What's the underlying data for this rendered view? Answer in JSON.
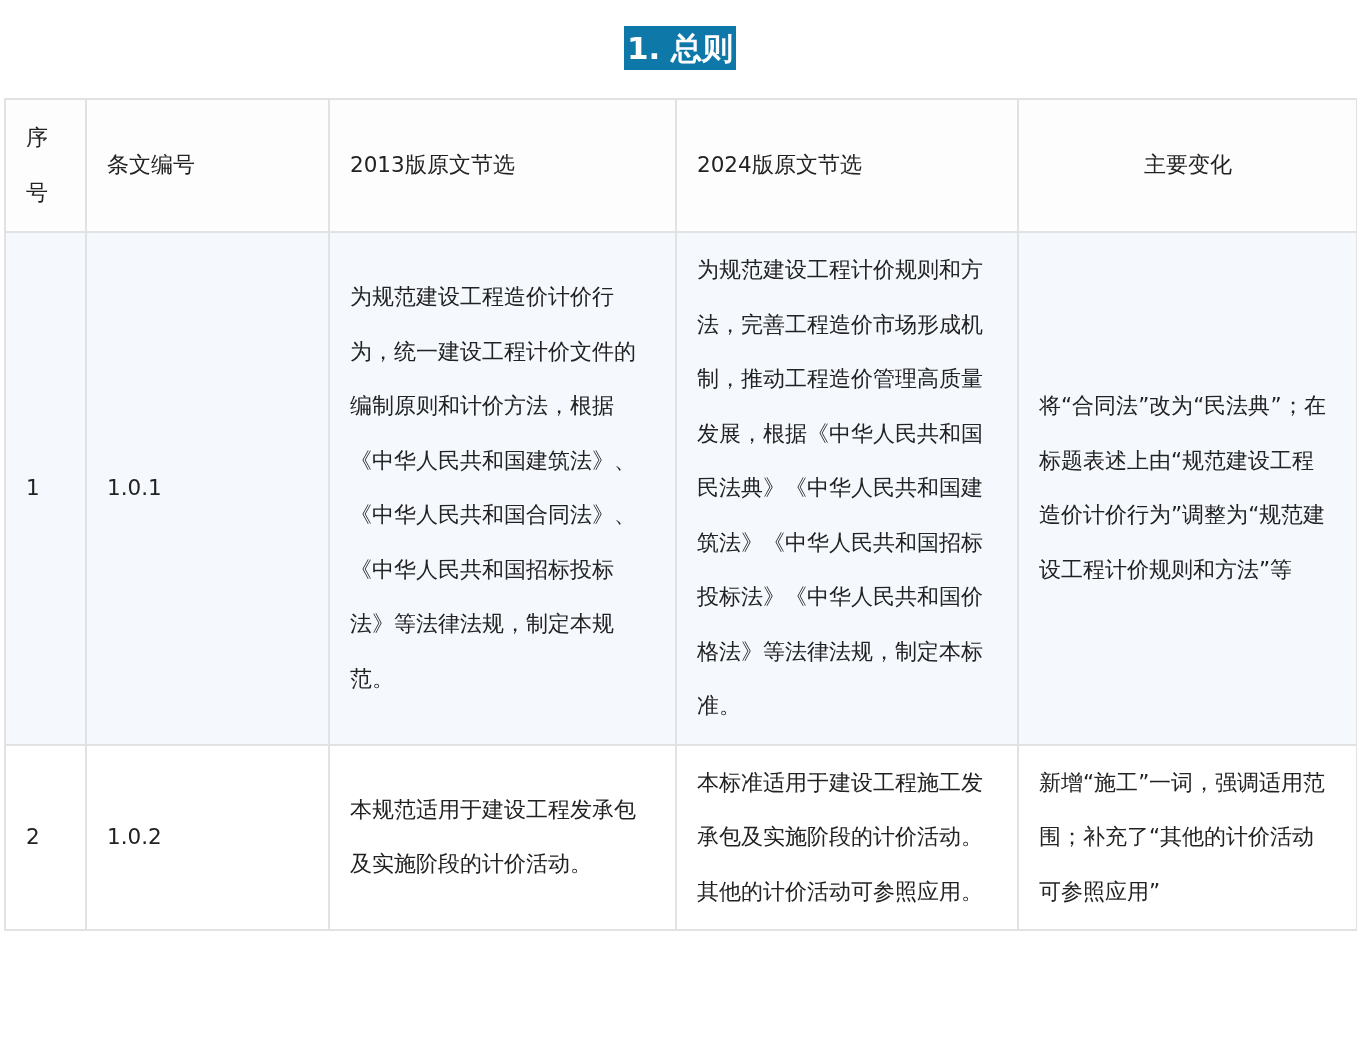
{
  "heading": "1. 总则",
  "table": {
    "columns": [
      "序号",
      "条文编号",
      "2013版原文节选",
      "2024版原文节选",
      "主要变化"
    ],
    "rows": [
      {
        "cells": [
          "1",
          "1.0.1",
          "为规范建设工程造价计价行为，统一建设工程计价文件的编制原则和计价方法，根据《中华人民共和国建筑法》、《中华人民共和国合同法》、《中华人民共和国招标投标法》等法律法规，制定本规范。",
          "为规范建设工程计价规则和方法，完善工程造价市场形成机制，推动工程造价管理高质量发展，根据《中华人民共和国民法典》《中华人民共和国建筑法》《中华人民共和国招标投标法》《中华人民共和国价格法》等法律法规，制定本标准。",
          "将“合同法”改为“民法典”；在标题表述上由“规范建设工程造价计价行为”调整为“规范建设工程计价规则和方法”等"
        ]
      },
      {
        "cells": [
          "2",
          "1.0.2",
          "本规范适用于建设工程发承包及实施阶段的计价活动。",
          "本标准适用于建设工程施工发承包及实施阶段的计价活动。其他的计价活动可参照应用。",
          "新增“施工”一词，强调适用范围；补充了“其他的计价活动可参照应用”"
        ]
      }
    ]
  }
}
